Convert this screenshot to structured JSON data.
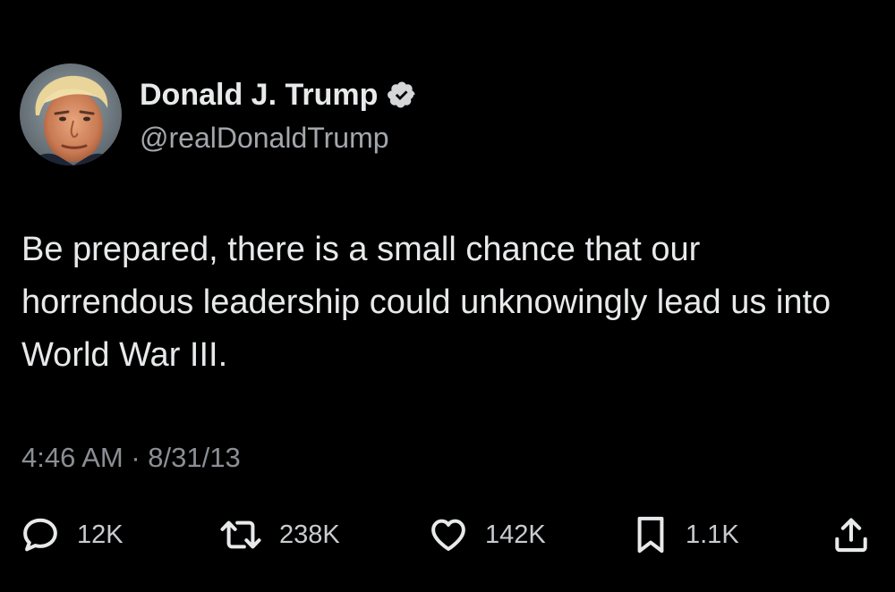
{
  "author": {
    "display_name": "Donald J. Trump",
    "handle": "@realDonaldTrump",
    "verified": true
  },
  "tweet": {
    "text": "Be prepared, there is a small chance that our horrendous leadership could unknowingly lead us into World War III.",
    "timestamp": "4:46 AM · 8/31/13"
  },
  "actions": {
    "replies": "12K",
    "retweets": "238K",
    "likes": "142K",
    "bookmarks": "1.1K"
  },
  "icons": {
    "reply": "speech-bubble-icon",
    "retweet": "retweet-arrows-icon",
    "like": "heart-icon",
    "bookmark": "bookmark-icon",
    "share": "share-upload-icon",
    "verified": "verified-badge-icon"
  },
  "colors": {
    "background": "#000000",
    "text_primary": "#e7e9ea",
    "text_secondary": "#8b8f94",
    "verified_badge": "#d4d6d8"
  }
}
